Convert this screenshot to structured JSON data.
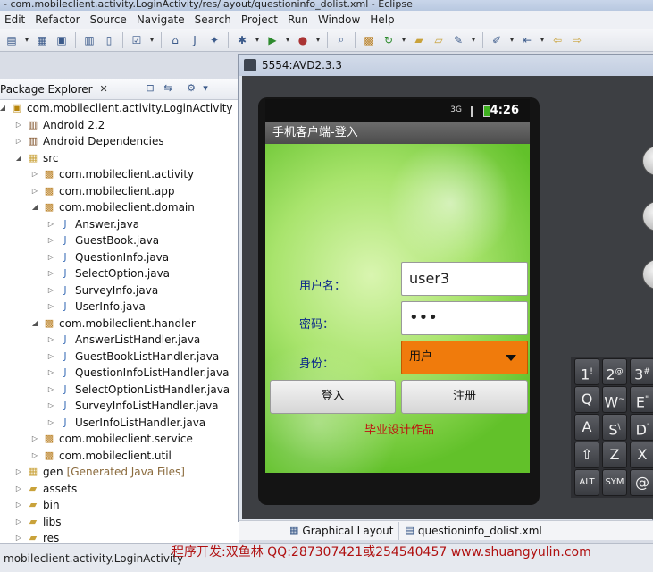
{
  "window_title": "- com.mobileclient.activity.LoginActivity/res/layout/questioninfo_dolist.xml - Eclipse",
  "menu": [
    "Edit",
    "Refactor",
    "Source",
    "Navigate",
    "Search",
    "Project",
    "Run",
    "Window",
    "Help"
  ],
  "package_explorer": {
    "tab_label": "Package Explorer",
    "tree": [
      {
        "label": "com.mobileclient.activity.LoginActivity",
        "depth": 0,
        "icon": "project",
        "expanded": true
      },
      {
        "label": "Android 2.2",
        "depth": 1,
        "icon": "library",
        "expanded": false
      },
      {
        "label": "Android Dependencies",
        "depth": 1,
        "icon": "library",
        "expanded": false
      },
      {
        "label": "src",
        "depth": 1,
        "icon": "source-folder",
        "expanded": true
      },
      {
        "label": "com.mobileclient.activity",
        "depth": 2,
        "icon": "package",
        "expanded": false
      },
      {
        "label": "com.mobileclient.app",
        "depth": 2,
        "icon": "package",
        "expanded": false
      },
      {
        "label": "com.mobileclient.domain",
        "depth": 2,
        "icon": "package",
        "expanded": true
      },
      {
        "label": "Answer.java",
        "depth": 3,
        "icon": "java-file",
        "expanded": false
      },
      {
        "label": "GuestBook.java",
        "depth": 3,
        "icon": "java-file",
        "expanded": false
      },
      {
        "label": "QuestionInfo.java",
        "depth": 3,
        "icon": "java-file",
        "expanded": false
      },
      {
        "label": "SelectOption.java",
        "depth": 3,
        "icon": "java-file",
        "expanded": false
      },
      {
        "label": "SurveyInfo.java",
        "depth": 3,
        "icon": "java-file",
        "expanded": false
      },
      {
        "label": "UserInfo.java",
        "depth": 3,
        "icon": "java-file",
        "expanded": false
      },
      {
        "label": "com.mobileclient.handler",
        "depth": 2,
        "icon": "package",
        "expanded": true
      },
      {
        "label": "AnswerListHandler.java",
        "depth": 3,
        "icon": "java-file",
        "expanded": false
      },
      {
        "label": "GuestBookListHandler.java",
        "depth": 3,
        "icon": "java-file",
        "expanded": false
      },
      {
        "label": "QuestionInfoListHandler.java",
        "depth": 3,
        "icon": "java-file",
        "expanded": false
      },
      {
        "label": "SelectOptionListHandler.java",
        "depth": 3,
        "icon": "java-file",
        "expanded": false
      },
      {
        "label": "SurveyInfoListHandler.java",
        "depth": 3,
        "icon": "java-file",
        "expanded": false
      },
      {
        "label": "UserInfoListHandler.java",
        "depth": 3,
        "icon": "java-file",
        "expanded": false
      },
      {
        "label": "com.mobileclient.service",
        "depth": 2,
        "icon": "package",
        "expanded": false
      },
      {
        "label": "com.mobileclient.util",
        "depth": 2,
        "icon": "package",
        "expanded": false
      },
      {
        "label": "gen",
        "suffix": "[Generated Java Files]",
        "depth": 1,
        "icon": "source-folder",
        "expanded": false
      },
      {
        "label": "assets",
        "depth": 1,
        "icon": "folder",
        "expanded": false
      },
      {
        "label": "bin",
        "depth": 1,
        "icon": "folder",
        "expanded": false
      },
      {
        "label": "libs",
        "depth": 1,
        "icon": "folder",
        "expanded": false
      },
      {
        "label": "res",
        "depth": 1,
        "icon": "folder",
        "expanded": false
      }
    ]
  },
  "emulator": {
    "title": "5554:AVD2.3.3",
    "clock": "4:26",
    "network": "3G",
    "app_title": "手机客户端-登入",
    "username_label": "用户名：",
    "username_value": "user3",
    "password_label": "密码：",
    "password_value": "•••",
    "role_label": "身份：",
    "role_value": "用户",
    "login_button": "登入",
    "register_button": "注册",
    "footnote": "毕业设计作品",
    "keys": [
      {
        "main": "1",
        "alt": "!"
      },
      {
        "main": "2",
        "alt": "@"
      },
      {
        "main": "3",
        "alt": "#"
      },
      {
        "main": "Q",
        "alt": ""
      },
      {
        "main": "W",
        "alt": "~"
      },
      {
        "main": "E",
        "alt": "\""
      },
      {
        "main": "A",
        "alt": ""
      },
      {
        "main": "S",
        "alt": "\\"
      },
      {
        "main": "D",
        "alt": "'"
      },
      {
        "main": "⇧",
        "alt": ""
      },
      {
        "main": "Z",
        "alt": ""
      },
      {
        "main": "X",
        "alt": ""
      },
      {
        "main": "ALT",
        "alt": ""
      },
      {
        "main": "SYM",
        "alt": ""
      },
      {
        "main": "@",
        "alt": ""
      }
    ]
  },
  "editor_tabs": [
    "Graphical Layout",
    "questioninfo_dolist.xml"
  ],
  "status_bar": {
    "left": "mobileclient.activity.LoginActivity",
    "banner": "程序开发:双鱼林 QQ:287307421或254540457 www.shuangyulin.com"
  },
  "colors": {
    "spinner": "#f07b0c",
    "app_background": "#6cc830",
    "label_text": "#0d2a8a",
    "footnote_text": "#c01010"
  }
}
